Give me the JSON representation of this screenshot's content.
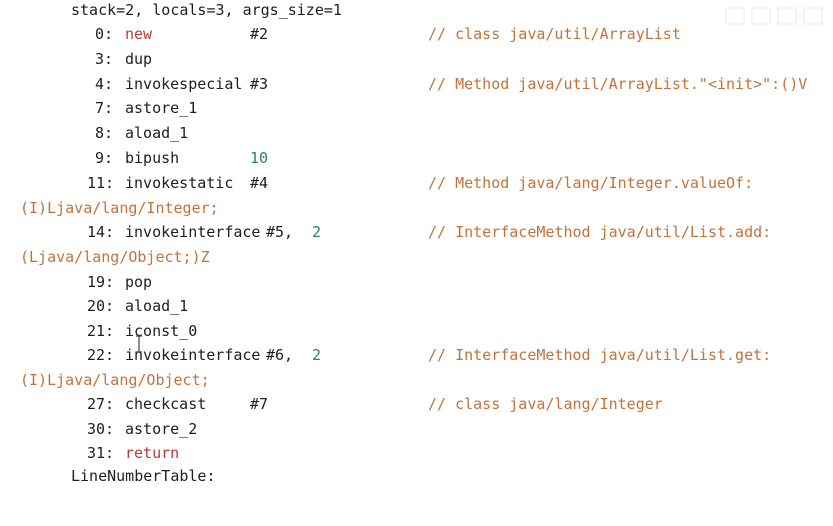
{
  "header": {
    "stack_info": "stack=2, locals=3, args_size=1"
  },
  "instructions": [
    {
      "offset": "0:",
      "opcode": "new",
      "operand": "#2",
      "comment": "// class java/util/ArrayList"
    },
    {
      "offset": "3:",
      "opcode": "dup"
    },
    {
      "offset": "4:",
      "opcode": "invokespecial",
      "operand": "#3",
      "comment": "// Method java/util/ArrayList.\"<init>\":()V"
    },
    {
      "offset": "7:",
      "opcode": "astore_1"
    },
    {
      "offset": "8:",
      "opcode": "aload_1"
    },
    {
      "offset": "9:",
      "opcode": "bipush",
      "arg": "10"
    },
    {
      "offset": "11:",
      "opcode": "invokestatic",
      "operand": "#4",
      "comment": "// Method java/lang/Integer.valueOf:"
    },
    {
      "continuation": "(I)Ljava/lang/Integer;"
    },
    {
      "offset": "14:",
      "opcode": "invokeinterface",
      "operand": "#5,",
      "arg": "2",
      "comment": "// InterfaceMethod java/util/List.add:"
    },
    {
      "continuation": "(Ljava/lang/Object;)Z"
    },
    {
      "offset": "19:",
      "opcode": "pop"
    },
    {
      "offset": "20:",
      "opcode": "aload_1"
    },
    {
      "offset": "21:",
      "opcode": "iconst_0"
    },
    {
      "offset": "22:",
      "opcode": "invokeinterface",
      "operand": "#6,",
      "arg": "2",
      "comment": "// InterfaceMethod java/util/List.get:"
    },
    {
      "continuation": "(I)Ljava/lang/Object;"
    },
    {
      "offset": "27:",
      "opcode": "checkcast",
      "operand": "#7",
      "comment": "// class java/lang/Integer"
    },
    {
      "offset": "30:",
      "opcode": "astore_2"
    },
    {
      "offset": "31:",
      "opcode": "return"
    }
  ],
  "footer": {
    "section_label": "LineNumberTable:"
  },
  "colors": {
    "keyword": "#b33a3a",
    "number": "#2f7d6d",
    "comment": "#c0733d",
    "text": "#1e1e1e"
  },
  "icons": {
    "cursor": "text-cursor-icon"
  }
}
